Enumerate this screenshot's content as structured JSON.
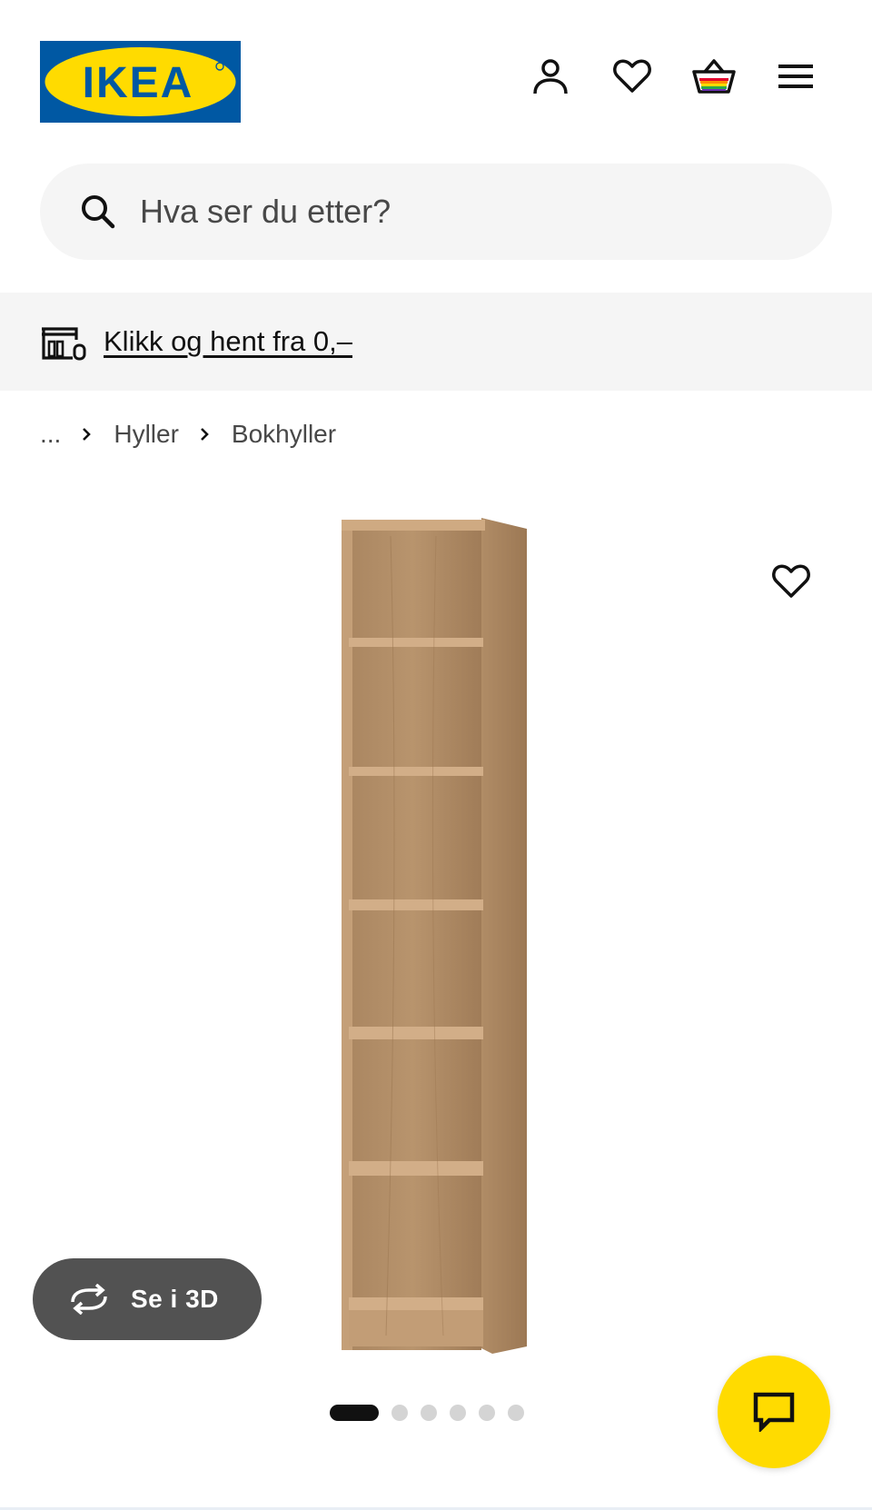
{
  "brand": {
    "name": "IKEA",
    "colors": {
      "blue": "#0058a3",
      "yellow": "#ffdb00"
    }
  },
  "header": {
    "icons": [
      "profile-icon",
      "heart-icon",
      "basket-icon",
      "menu-icon"
    ]
  },
  "search": {
    "placeholder": "Hva ser du etter?",
    "icon": "search-icon"
  },
  "promo": {
    "icon": "store-pickup-icon",
    "text": "Klikk og hent fra 0,–"
  },
  "breadcrumb": {
    "ellipsis": "...",
    "items": [
      "Hyller",
      "Bokhyller"
    ]
  },
  "product": {
    "image": "bookcase-oak-effect",
    "favorite_icon": "heart-icon"
  },
  "view_3d": {
    "label": "Se i 3D",
    "icon": "rotate-icon"
  },
  "carousel": {
    "total": 6,
    "active_index": 0
  },
  "chat": {
    "icon": "chat-icon"
  }
}
